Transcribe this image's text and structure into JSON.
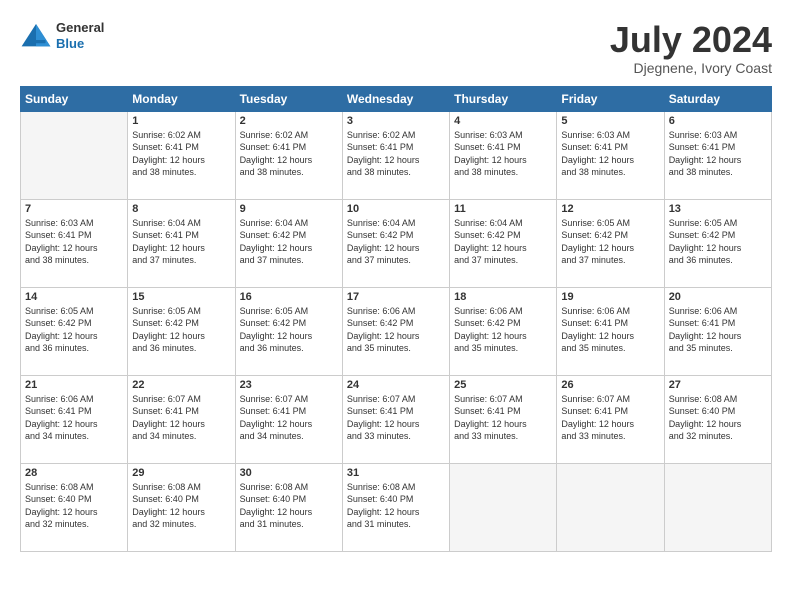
{
  "header": {
    "logo_line1": "General",
    "logo_line2": "Blue",
    "main_title": "July 2024",
    "subtitle": "Djegnene, Ivory Coast"
  },
  "days_of_week": [
    "Sunday",
    "Monday",
    "Tuesday",
    "Wednesday",
    "Thursday",
    "Friday",
    "Saturday"
  ],
  "weeks": [
    [
      {
        "day": "",
        "info": ""
      },
      {
        "day": "1",
        "info": "Sunrise: 6:02 AM\nSunset: 6:41 PM\nDaylight: 12 hours\nand 38 minutes."
      },
      {
        "day": "2",
        "info": "Sunrise: 6:02 AM\nSunset: 6:41 PM\nDaylight: 12 hours\nand 38 minutes."
      },
      {
        "day": "3",
        "info": "Sunrise: 6:02 AM\nSunset: 6:41 PM\nDaylight: 12 hours\nand 38 minutes."
      },
      {
        "day": "4",
        "info": "Sunrise: 6:03 AM\nSunset: 6:41 PM\nDaylight: 12 hours\nand 38 minutes."
      },
      {
        "day": "5",
        "info": "Sunrise: 6:03 AM\nSunset: 6:41 PM\nDaylight: 12 hours\nand 38 minutes."
      },
      {
        "day": "6",
        "info": "Sunrise: 6:03 AM\nSunset: 6:41 PM\nDaylight: 12 hours\nand 38 minutes."
      }
    ],
    [
      {
        "day": "7",
        "info": "Sunrise: 6:03 AM\nSunset: 6:41 PM\nDaylight: 12 hours\nand 38 minutes."
      },
      {
        "day": "8",
        "info": "Sunrise: 6:04 AM\nSunset: 6:41 PM\nDaylight: 12 hours\nand 37 minutes."
      },
      {
        "day": "9",
        "info": "Sunrise: 6:04 AM\nSunset: 6:42 PM\nDaylight: 12 hours\nand 37 minutes."
      },
      {
        "day": "10",
        "info": "Sunrise: 6:04 AM\nSunset: 6:42 PM\nDaylight: 12 hours\nand 37 minutes."
      },
      {
        "day": "11",
        "info": "Sunrise: 6:04 AM\nSunset: 6:42 PM\nDaylight: 12 hours\nand 37 minutes."
      },
      {
        "day": "12",
        "info": "Sunrise: 6:05 AM\nSunset: 6:42 PM\nDaylight: 12 hours\nand 37 minutes."
      },
      {
        "day": "13",
        "info": "Sunrise: 6:05 AM\nSunset: 6:42 PM\nDaylight: 12 hours\nand 36 minutes."
      }
    ],
    [
      {
        "day": "14",
        "info": "Sunrise: 6:05 AM\nSunset: 6:42 PM\nDaylight: 12 hours\nand 36 minutes."
      },
      {
        "day": "15",
        "info": "Sunrise: 6:05 AM\nSunset: 6:42 PM\nDaylight: 12 hours\nand 36 minutes."
      },
      {
        "day": "16",
        "info": "Sunrise: 6:05 AM\nSunset: 6:42 PM\nDaylight: 12 hours\nand 36 minutes."
      },
      {
        "day": "17",
        "info": "Sunrise: 6:06 AM\nSunset: 6:42 PM\nDaylight: 12 hours\nand 35 minutes."
      },
      {
        "day": "18",
        "info": "Sunrise: 6:06 AM\nSunset: 6:42 PM\nDaylight: 12 hours\nand 35 minutes."
      },
      {
        "day": "19",
        "info": "Sunrise: 6:06 AM\nSunset: 6:41 PM\nDaylight: 12 hours\nand 35 minutes."
      },
      {
        "day": "20",
        "info": "Sunrise: 6:06 AM\nSunset: 6:41 PM\nDaylight: 12 hours\nand 35 minutes."
      }
    ],
    [
      {
        "day": "21",
        "info": "Sunrise: 6:06 AM\nSunset: 6:41 PM\nDaylight: 12 hours\nand 34 minutes."
      },
      {
        "day": "22",
        "info": "Sunrise: 6:07 AM\nSunset: 6:41 PM\nDaylight: 12 hours\nand 34 minutes."
      },
      {
        "day": "23",
        "info": "Sunrise: 6:07 AM\nSunset: 6:41 PM\nDaylight: 12 hours\nand 34 minutes."
      },
      {
        "day": "24",
        "info": "Sunrise: 6:07 AM\nSunset: 6:41 PM\nDaylight: 12 hours\nand 33 minutes."
      },
      {
        "day": "25",
        "info": "Sunrise: 6:07 AM\nSunset: 6:41 PM\nDaylight: 12 hours\nand 33 minutes."
      },
      {
        "day": "26",
        "info": "Sunrise: 6:07 AM\nSunset: 6:41 PM\nDaylight: 12 hours\nand 33 minutes."
      },
      {
        "day": "27",
        "info": "Sunrise: 6:08 AM\nSunset: 6:40 PM\nDaylight: 12 hours\nand 32 minutes."
      }
    ],
    [
      {
        "day": "28",
        "info": "Sunrise: 6:08 AM\nSunset: 6:40 PM\nDaylight: 12 hours\nand 32 minutes."
      },
      {
        "day": "29",
        "info": "Sunrise: 6:08 AM\nSunset: 6:40 PM\nDaylight: 12 hours\nand 32 minutes."
      },
      {
        "day": "30",
        "info": "Sunrise: 6:08 AM\nSunset: 6:40 PM\nDaylight: 12 hours\nand 31 minutes."
      },
      {
        "day": "31",
        "info": "Sunrise: 6:08 AM\nSunset: 6:40 PM\nDaylight: 12 hours\nand 31 minutes."
      },
      {
        "day": "",
        "info": ""
      },
      {
        "day": "",
        "info": ""
      },
      {
        "day": "",
        "info": ""
      }
    ]
  ]
}
